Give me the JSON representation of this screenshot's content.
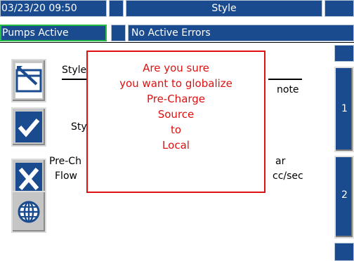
{
  "header": {
    "datetime": "03/23/20 09:50",
    "title": "Style",
    "status": "Pumps Active",
    "errors": "No Active Errors"
  },
  "tabs": [
    "1",
    "2"
  ],
  "content": {
    "style_label": "Style",
    "note_suffix": "note",
    "style_field_label": "Sty",
    "precharge_label": "Pre-Ch",
    "flow_label": "Flow",
    "unit_suffix_1": "ar",
    "unit_suffix_2": "cc/sec"
  },
  "dialog": {
    "lines": [
      "Are you sure",
      "you want to globalize",
      "Pre-Charge",
      "Source",
      "to",
      "Local"
    ]
  },
  "colors": {
    "header_bg": "#1a4b8f",
    "dialog_border": "#e01010",
    "dialog_text": "#e01010"
  }
}
